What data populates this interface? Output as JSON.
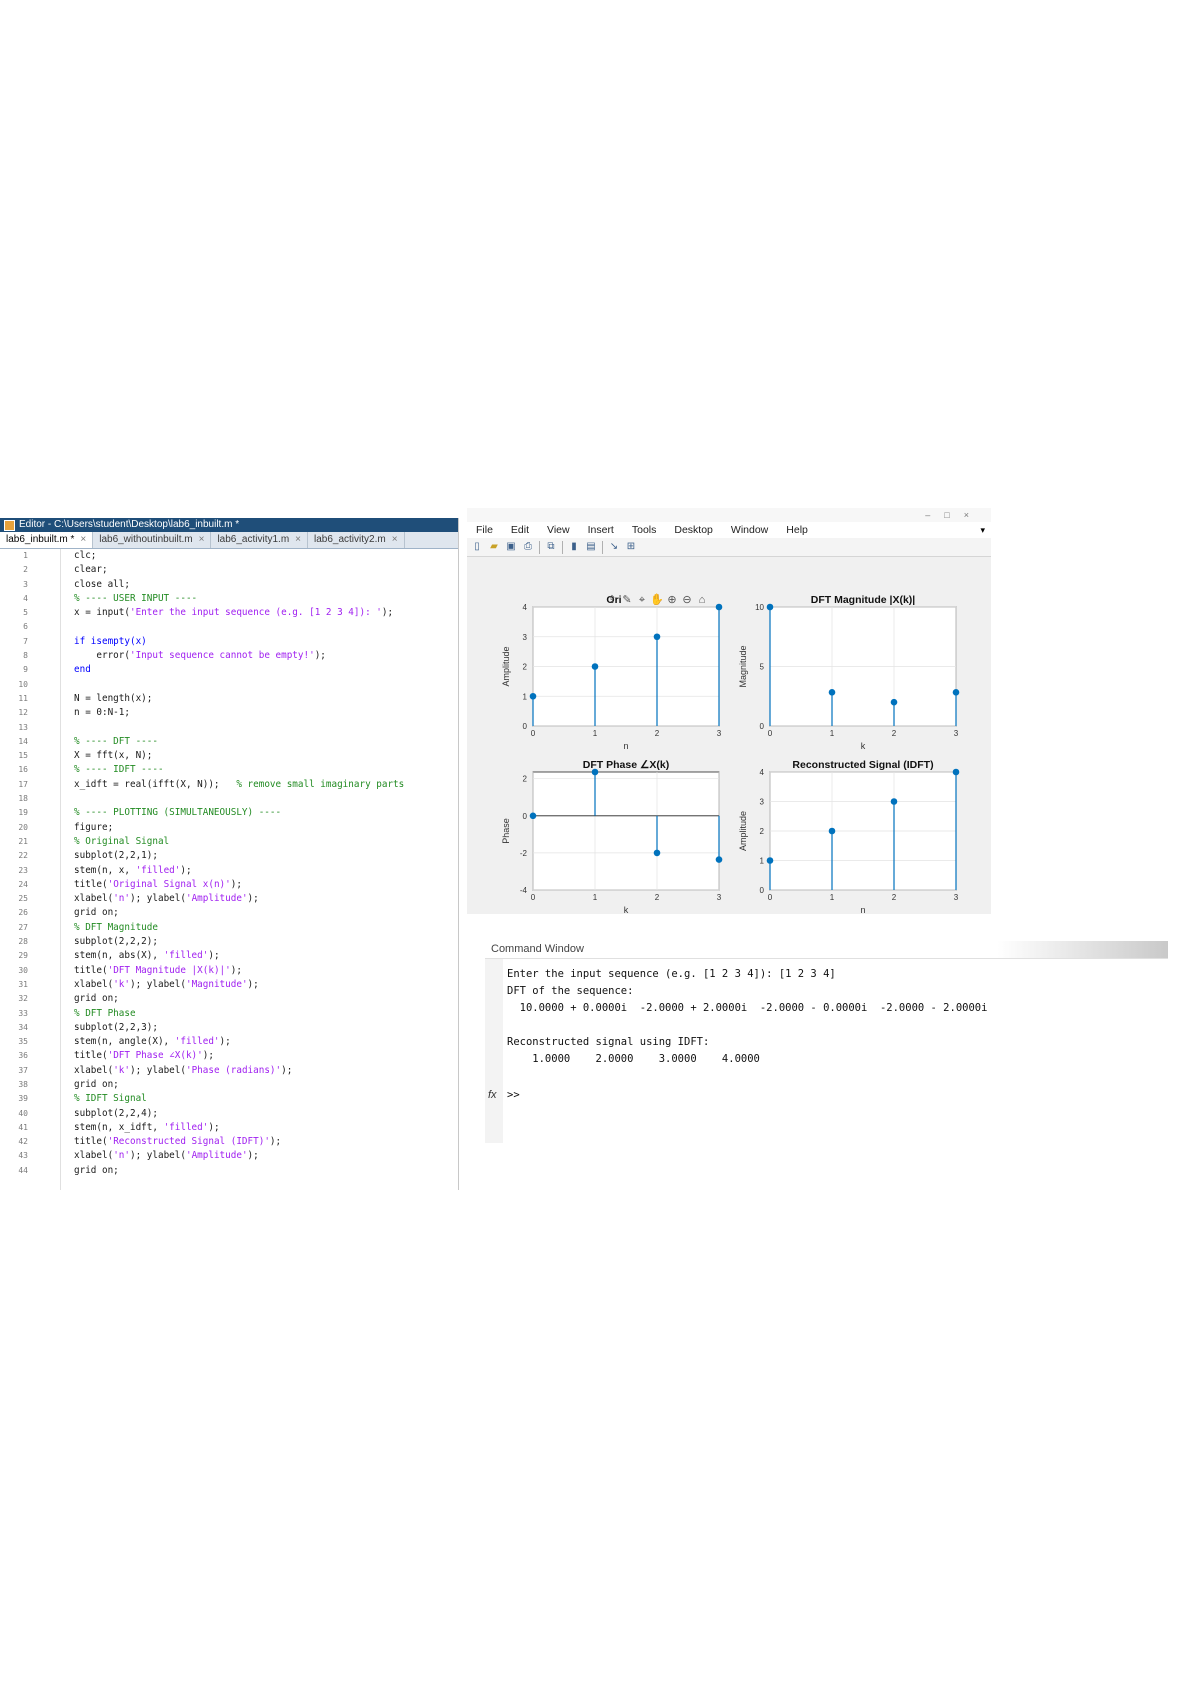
{
  "editor": {
    "title": "Editor - C:\\Users\\student\\Desktop\\lab6_inbuilt.m *",
    "tabs": [
      {
        "label": "lab6_inbuilt.m *"
      },
      {
        "label": "lab6_withoutinbuilt.m"
      },
      {
        "label": "lab6_activity1.m"
      },
      {
        "label": "lab6_activity2.m"
      }
    ],
    "lines": [
      {
        "n": "1",
        "text": "clc;",
        "kind": "code"
      },
      {
        "n": "2",
        "text": "clear;",
        "kind": "code"
      },
      {
        "n": "3",
        "text": "close all;",
        "kind": "code"
      },
      {
        "n": "4",
        "text": "% ---- USER INPUT ----",
        "kind": "comment"
      },
      {
        "n": "5",
        "text": "x = input('Enter the input sequence (e.g. [1 2 3 4]): ');",
        "kind": "code"
      },
      {
        "n": "6",
        "text": "",
        "kind": "code"
      },
      {
        "n": "7",
        "text": "if isempty(x)",
        "kind": "keyword"
      },
      {
        "n": "8",
        "text": "    error('Input sequence cannot be empty!');",
        "kind": "code"
      },
      {
        "n": "9",
        "text": "end",
        "kind": "keyword"
      },
      {
        "n": "10",
        "text": "",
        "kind": "code"
      },
      {
        "n": "11",
        "text": "N = length(x);",
        "kind": "code"
      },
      {
        "n": "12",
        "text": "n = 0:N-1;",
        "kind": "code"
      },
      {
        "n": "13",
        "text": "",
        "kind": "code"
      },
      {
        "n": "14",
        "text": "% ---- DFT ----",
        "kind": "comment"
      },
      {
        "n": "15",
        "text": "X = fft(x, N);",
        "kind": "code"
      },
      {
        "n": "16",
        "text": "% ---- IDFT ----",
        "kind": "comment"
      },
      {
        "n": "17",
        "text": "x_idft = real(ifft(X, N));   % remove small imaginary parts",
        "kind": "code"
      },
      {
        "n": "18",
        "text": "",
        "kind": "code"
      },
      {
        "n": "19",
        "text": "% ---- PLOTTING (SIMULTANEOUSLY) ----",
        "kind": "comment"
      },
      {
        "n": "20",
        "text": "figure;",
        "kind": "code"
      },
      {
        "n": "21",
        "text": "% Original Signal",
        "kind": "comment"
      },
      {
        "n": "22",
        "text": "subplot(2,2,1);",
        "kind": "code"
      },
      {
        "n": "23",
        "text": "stem(n, x, 'filled');",
        "kind": "code"
      },
      {
        "n": "24",
        "text": "title('Original Signal x(n)');",
        "kind": "code"
      },
      {
        "n": "25",
        "text": "xlabel('n'); ylabel('Amplitude');",
        "kind": "code"
      },
      {
        "n": "26",
        "text": "grid on;",
        "kind": "code"
      },
      {
        "n": "27",
        "text": "% DFT Magnitude",
        "kind": "comment"
      },
      {
        "n": "28",
        "text": "subplot(2,2,2);",
        "kind": "code"
      },
      {
        "n": "29",
        "text": "stem(n, abs(X), 'filled');",
        "kind": "code"
      },
      {
        "n": "30",
        "text": "title('DFT Magnitude |X(k)|');",
        "kind": "code"
      },
      {
        "n": "31",
        "text": "xlabel('k'); ylabel('Magnitude');",
        "kind": "code"
      },
      {
        "n": "32",
        "text": "grid on;",
        "kind": "code"
      },
      {
        "n": "33",
        "text": "% DFT Phase",
        "kind": "comment"
      },
      {
        "n": "34",
        "text": "subplot(2,2,3);",
        "kind": "code"
      },
      {
        "n": "35",
        "text": "stem(n, angle(X), 'filled');",
        "kind": "code"
      },
      {
        "n": "36",
        "text": "title('DFT Phase ∠X(k)');",
        "kind": "code"
      },
      {
        "n": "37",
        "text": "xlabel('k'); ylabel('Phase (radians)');",
        "kind": "code"
      },
      {
        "n": "38",
        "text": "grid on;",
        "kind": "code"
      },
      {
        "n": "39",
        "text": "% IDFT Signal",
        "kind": "comment"
      },
      {
        "n": "40",
        "text": "subplot(2,2,4);",
        "kind": "code"
      },
      {
        "n": "41",
        "text": "stem(n, x_idft, 'filled');",
        "kind": "code"
      },
      {
        "n": "42",
        "text": "title('Reconstructed Signal (IDFT)');",
        "kind": "code"
      },
      {
        "n": "43",
        "text": "xlabel('n'); ylabel('Amplitude');",
        "kind": "code"
      },
      {
        "n": "44",
        "text": "grid on;",
        "kind": "code"
      }
    ]
  },
  "figure": {
    "menu": [
      "File",
      "Edit",
      "View",
      "Insert",
      "Tools",
      "Desktop",
      "Window",
      "Help"
    ],
    "toolbar_icons": [
      "new-figure-icon",
      "open-icon",
      "save-icon",
      "print-icon",
      "link-icon",
      "insert-colorbar-icon",
      "insert-legend-icon",
      "brush-icon",
      "plot-tools-icon"
    ],
    "axes_toolbar_icons": [
      "export-icon",
      "brush-icon",
      "datatip-icon",
      "pan-icon",
      "zoom-in-icon",
      "zoom-out-icon",
      "home-icon"
    ]
  },
  "chart_data": [
    {
      "type": "stem",
      "title": "",
      "title_partial": "Ori",
      "xlabel": "n",
      "ylabel": "Amplitude",
      "x": [
        0,
        1,
        2,
        3
      ],
      "values": [
        1,
        2,
        3,
        4
      ],
      "xlim": [
        0,
        3
      ],
      "ylim": [
        0,
        4
      ],
      "xticks": [
        "0",
        "1",
        "2",
        "3"
      ],
      "yticks": [
        "0",
        "1",
        "2",
        "3",
        "4"
      ],
      "grid": true,
      "color": "#0072bd"
    },
    {
      "type": "stem",
      "title": "DFT Magnitude |X(k)|",
      "xlabel": "k",
      "ylabel": "Magnitude",
      "x": [
        0,
        1,
        2,
        3
      ],
      "values": [
        10,
        2.83,
        2,
        2.83
      ],
      "xlim": [
        0,
        3
      ],
      "ylim": [
        0,
        10
      ],
      "xticks": [
        "0",
        "1",
        "2",
        "3"
      ],
      "yticks": [
        "0",
        "5",
        "10"
      ],
      "grid": true,
      "color": "#0072bd"
    },
    {
      "type": "stem",
      "title": "DFT Phase ∠X(k)",
      "xlabel": "k",
      "ylabel": "Phase",
      "x": [
        0,
        1,
        2,
        3
      ],
      "values": [
        0,
        2.36,
        -2,
        -2.36
      ],
      "xlim": [
        0,
        3
      ],
      "ylim": [
        -4,
        2.36
      ],
      "xticks": [
        "0",
        "1",
        "2",
        "3"
      ],
      "yticks": [
        "2",
        "0",
        "-2",
        "-4"
      ],
      "grid": true,
      "color": "#0072bd"
    },
    {
      "type": "stem",
      "title": "Reconstructed Signal (IDFT)",
      "xlabel": "n",
      "ylabel": "Amplitude",
      "x": [
        0,
        1,
        2,
        3
      ],
      "values": [
        1,
        2,
        3,
        4
      ],
      "xlim": [
        0,
        3
      ],
      "ylim": [
        0,
        4
      ],
      "xticks": [
        "0",
        "1",
        "2",
        "3"
      ],
      "yticks": [
        "0",
        "1",
        "2",
        "3",
        "4"
      ],
      "grid": true,
      "color": "#0072bd"
    }
  ],
  "command_window": {
    "title": "Command Window",
    "lines": [
      "Enter the input sequence (e.g. [1 2 3 4]): [1 2 3 4]",
      "DFT of the sequence:",
      "  10.0000 + 0.0000i  -2.0000 + 2.0000i  -2.0000 - 0.0000i  -2.0000 - 2.0000i",
      "",
      "Reconstructed signal using IDFT:",
      "    1.0000    2.0000    3.0000    4.0000",
      "",
      ">>"
    ],
    "fx_label": "fx"
  }
}
